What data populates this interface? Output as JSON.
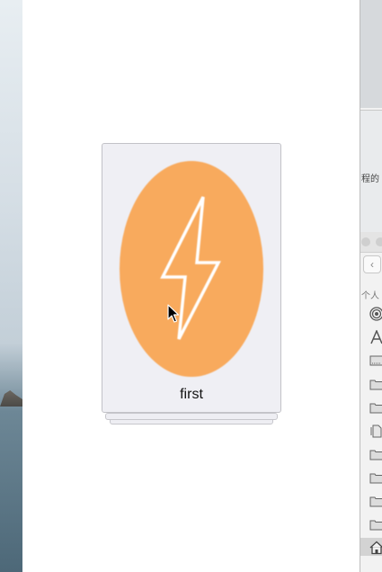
{
  "card": {
    "title": "first",
    "image_color": "#f8aa5d",
    "icon": "lightning-bolt-icon"
  },
  "finder": {
    "doc_text": "程的",
    "sidebar_header": "个人",
    "back_label": "‹",
    "sidebar_items": [
      {
        "icon": "airdrop-icon"
      },
      {
        "icon": "applications-icon"
      },
      {
        "icon": "desktop-icon"
      },
      {
        "icon": "folder-icon"
      },
      {
        "icon": "folder-icon"
      },
      {
        "icon": "documents-icon"
      },
      {
        "icon": "folder-icon"
      },
      {
        "icon": "folder-icon"
      },
      {
        "icon": "folder-icon"
      },
      {
        "icon": "folder-icon"
      },
      {
        "icon": "home-icon"
      }
    ]
  }
}
